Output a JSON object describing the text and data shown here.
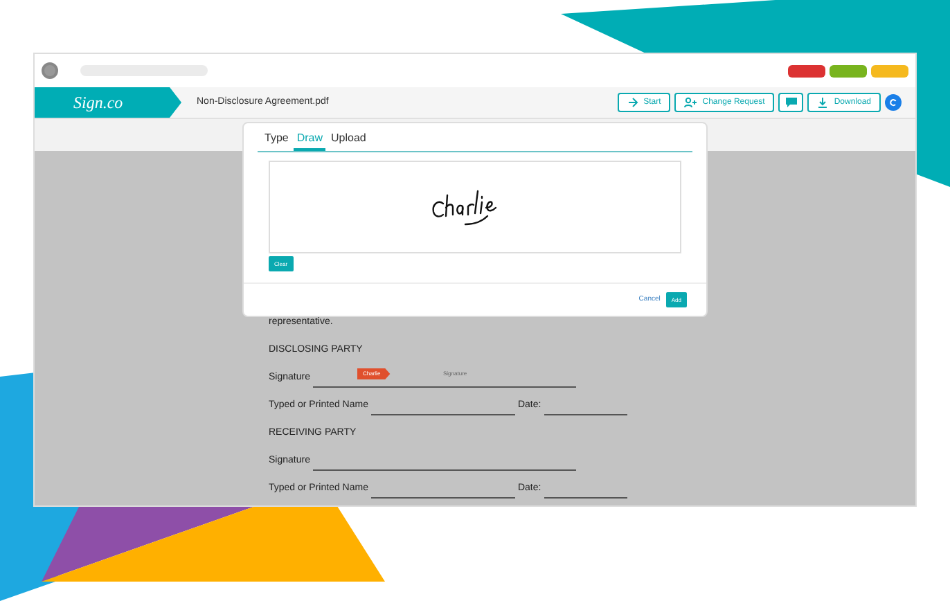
{
  "window_controls": [
    {
      "color": "#dc3232"
    },
    {
      "color": "#78b41e"
    },
    {
      "color": "#f5b91e"
    }
  ],
  "app": {
    "logo": "Sign.co",
    "filename": "Non-Disclosure Agreement.pdf"
  },
  "toolbar": [
    {
      "kind": "start",
      "label": "Start"
    },
    {
      "kind": "request",
      "label": "Change Request"
    },
    {
      "kind": "comment"
    },
    {
      "kind": "download",
      "label": "Download"
    },
    {
      "kind": "avatar"
    }
  ],
  "document": {
    "lines": [
      {
        "kind": "text",
        "text": "representative."
      },
      {
        "kind": "heading",
        "text": "DISCLOSING PARTY"
      },
      {
        "kind": "signature",
        "label": "Signature",
        "tag": "Charlie",
        "caption": "Signature"
      },
      {
        "kind": "name_date",
        "label": "Typed or Printed Name",
        "date_label": "Date:"
      },
      {
        "kind": "heading",
        "text": "RECEIVING PARTY"
      },
      {
        "kind": "signature",
        "label": "Signature"
      },
      {
        "kind": "name_date",
        "label": "Typed or Printed Name",
        "date_label": "Date:"
      }
    ]
  },
  "dialog": {
    "tabs": [
      {
        "label": "Type",
        "selected": false
      },
      {
        "label": "Draw",
        "selected": true
      },
      {
        "label": "Upload",
        "selected": false
      }
    ],
    "clear": "Clear",
    "cancel": "Cancel",
    "add": "Add"
  }
}
